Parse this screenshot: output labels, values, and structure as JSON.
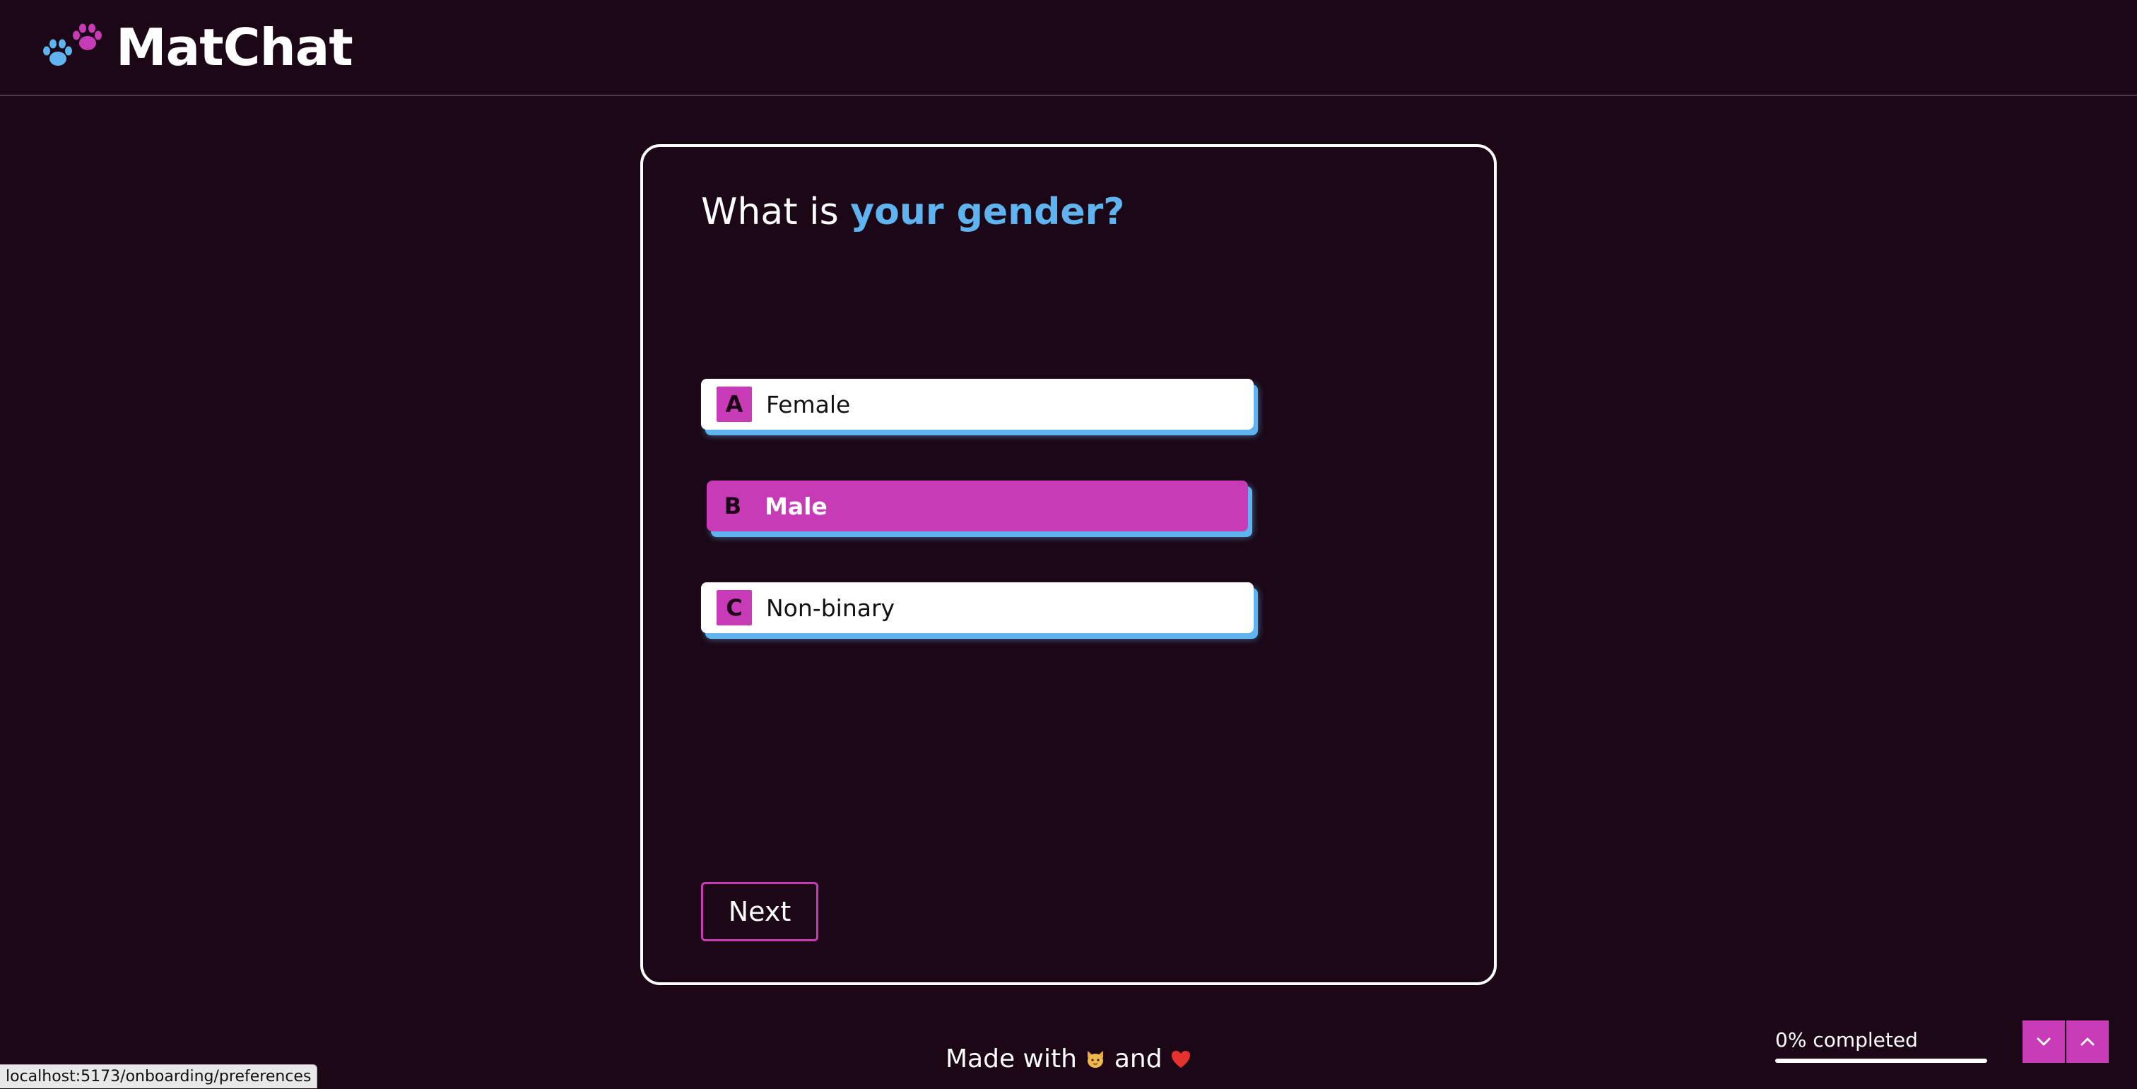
{
  "header": {
    "brand": "MatChat",
    "icons": [
      "paw-blue-icon",
      "paw-pink-icon"
    ]
  },
  "question": {
    "prefix": "What is ",
    "accent": "your gender?"
  },
  "options": [
    {
      "key": "A",
      "label": "Female",
      "selected": false
    },
    {
      "key": "B",
      "label": "Male",
      "selected": true
    },
    {
      "key": "C",
      "label": "Non-binary",
      "selected": false
    }
  ],
  "next_label": "Next",
  "footer": {
    "made_with": "Made with",
    "and": "and",
    "icons": [
      "cat-emoji-icon",
      "heart-icon"
    ]
  },
  "progress": {
    "text": "0% completed",
    "fraction": 0.0
  },
  "nav": {
    "icons": [
      "chevron-down-icon",
      "chevron-up-icon"
    ]
  },
  "status_url": "localhost:5173/onboarding/preferences",
  "colors": {
    "background": "#1b0716",
    "accent_pink": "#c83bb6",
    "accent_blue": "#5fb4f0",
    "white": "#ffffff"
  }
}
